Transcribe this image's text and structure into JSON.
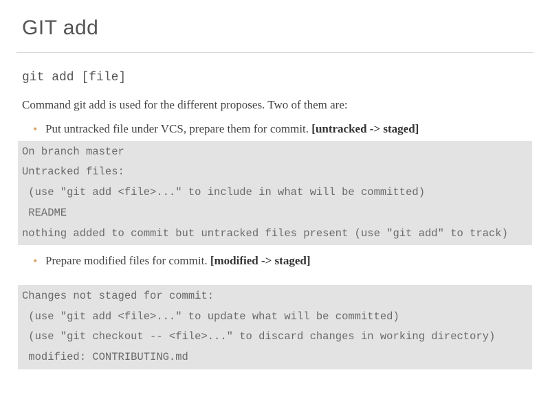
{
  "title": "GIT add",
  "command": "git add [file]",
  "intro": "Command git add is used for the different proposes. Two of them are:",
  "bullets": [
    {
      "text": "Put untracked file under VCS, prepare them for commit. ",
      "strong": "[untracked -> staged]"
    },
    {
      "text": "Prepare modified files for commit. ",
      "strong": "[modified -> staged]"
    }
  ],
  "codeblocks": [
    "On branch master\nUntracked files:\n (use \"git add <file>...\" to include in what will be committed)\n README\nnothing added to commit but untracked files present (use \"git add\" to track)",
    "Changes not staged for commit:\n (use \"git add <file>...\" to update what will be committed)\n (use \"git checkout -- <file>...\" to discard changes in working directory)\n modified: CONTRIBUTING.md"
  ]
}
